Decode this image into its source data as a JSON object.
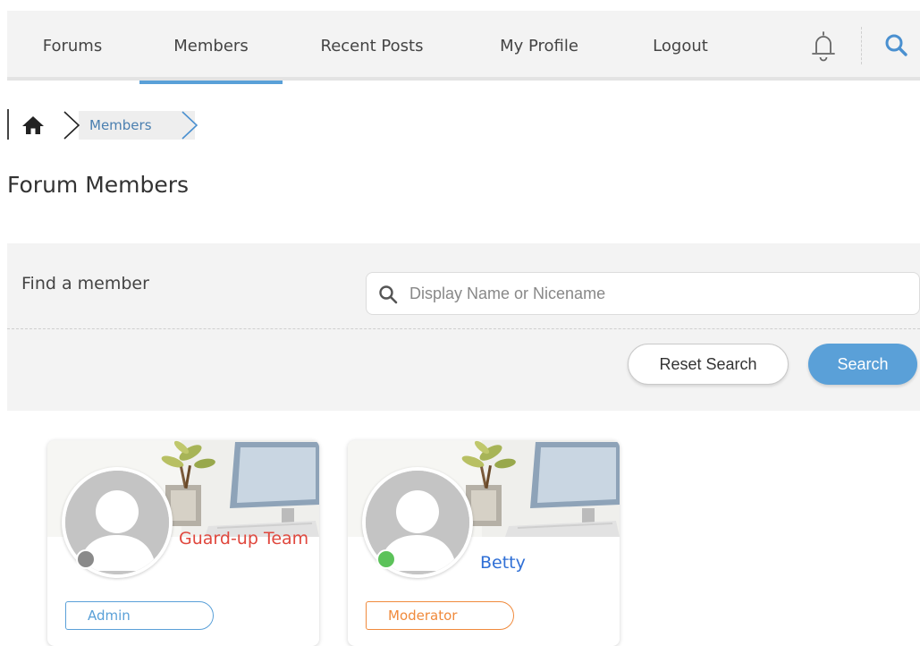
{
  "nav": {
    "items": [
      {
        "label": "Forums",
        "active": false
      },
      {
        "label": "Members",
        "active": true
      },
      {
        "label": "Recent Posts",
        "active": false
      },
      {
        "label": "My Profile",
        "active": false
      },
      {
        "label": "Logout",
        "active": false
      }
    ],
    "icons": [
      "bell-icon",
      "search-icon"
    ],
    "accent_color": "#5aa0d8"
  },
  "breadcrumb": {
    "home_icon": "home-icon",
    "current": "Members"
  },
  "page": {
    "title": "Forum Members"
  },
  "search": {
    "label": "Find a member",
    "placeholder": "Display Name or Nicename",
    "value": "",
    "reset_label": "Reset Search",
    "submit_label": "Search"
  },
  "members": [
    {
      "name": "Guard-up Team",
      "name_color": "#e0483e",
      "status": "offline",
      "status_color": "#8a8a8a",
      "role": "Admin",
      "role_color": "#5aa0d8"
    },
    {
      "name": "Betty",
      "name_color": "#2f6fd6",
      "status": "online",
      "status_color": "#5cc25a",
      "role": "Moderator",
      "role_color": "#f08a3c"
    }
  ]
}
